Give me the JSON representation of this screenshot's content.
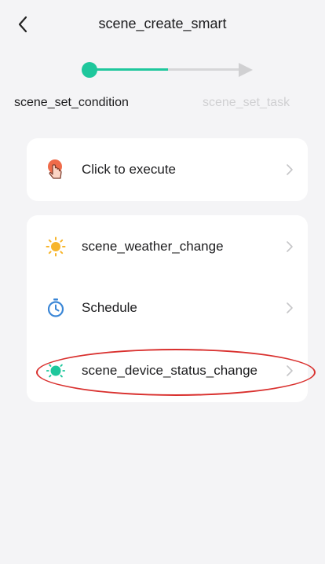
{
  "header": {
    "title": "scene_create_smart",
    "back_icon": "chevron-left-icon"
  },
  "stepper": {
    "steps": [
      {
        "label": "scene_set_condition",
        "active": true
      },
      {
        "label": "scene_set_task",
        "active": false
      }
    ],
    "active_color": "#1ec79c",
    "inactive_color": "#d0d0d2"
  },
  "card1": {
    "items": [
      {
        "label": "Click to execute",
        "icon": "hand-tap-icon"
      }
    ]
  },
  "card2": {
    "items": [
      {
        "label": "scene_weather_change",
        "icon": "sun-icon"
      },
      {
        "label": "Schedule",
        "icon": "timer-icon"
      },
      {
        "label": "scene_device_status_change",
        "icon": "device-bulb-icon"
      }
    ]
  },
  "annotation": {
    "highlight_color": "#d9302e"
  }
}
